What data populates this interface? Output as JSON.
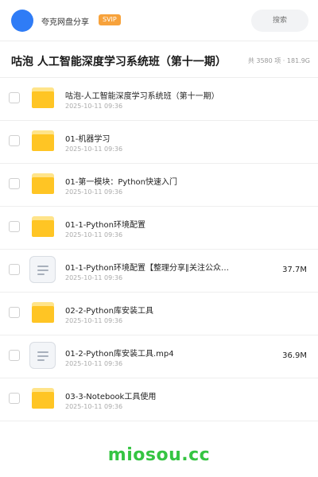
{
  "header": {
    "username": "夸克网盘分享",
    "badge": "SVIP",
    "search_placeholder": "搜索"
  },
  "page": {
    "title": "咕泡 人工智能深度学习系统班（第十一期）",
    "stats": "共 3580 项 · 181.9G"
  },
  "items": [
    {
      "type": "folder",
      "name": "咕泡-人工智能深度学习系统班（第十一期）",
      "date": "2025-10-11 09:36",
      "size": ""
    },
    {
      "type": "folder",
      "name": "01-机器学习",
      "date": "2025-10-11 09:36",
      "size": ""
    },
    {
      "type": "folder",
      "name": "01-第一模块：Python快速入门",
      "date": "2025-10-11 09:36",
      "size": ""
    },
    {
      "type": "folder",
      "name": "01-1-Python环境配置",
      "date": "2025-10-11 09:36",
      "size": ""
    },
    {
      "type": "file",
      "name": "01-1-Python环境配置【整理分享∥关注公众…",
      "date": "2025-10-11 09:36",
      "size": "37.7M"
    },
    {
      "type": "folder",
      "name": "02-2-Python库安装工具",
      "date": "2025-10-11 09:36",
      "size": ""
    },
    {
      "type": "file",
      "name": "01-2-Python库安装工具.mp4",
      "date": "2025-10-11 09:36",
      "size": "36.9M"
    },
    {
      "type": "folder",
      "name": "03-3-Notebook工具使用",
      "date": "2025-10-11 09:36",
      "size": ""
    }
  ],
  "watermark": "miosou.cc",
  "colors": {
    "accent": "#2f7cf6",
    "badge": "#f7a23b",
    "folder": "#ffc524",
    "watermark": "#35c442"
  },
  "icons": {
    "folder": "folder-icon",
    "file": "document-icon"
  }
}
